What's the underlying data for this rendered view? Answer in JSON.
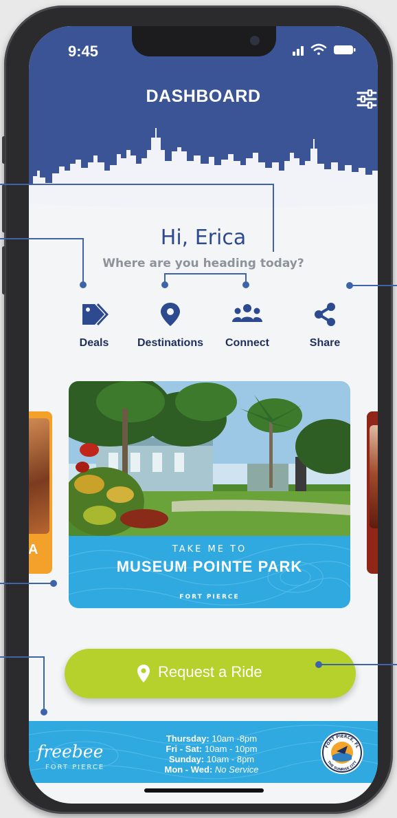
{
  "status": {
    "time": "9:45"
  },
  "header": {
    "title": "DASHBOARD"
  },
  "greeting": {
    "hello": "Hi, Erica",
    "question": "Where are you heading today?"
  },
  "quick_actions": [
    {
      "label": "Deals",
      "icon": "tag-icon"
    },
    {
      "label": "Destinations",
      "icon": "map-pin-icon"
    },
    {
      "label": "Connect",
      "icon": "users-icon"
    },
    {
      "label": "Share",
      "icon": "share-icon"
    }
  ],
  "destination_card": {
    "pre": "TAKE ME TO",
    "name": "MUSEUM POINTE PARK",
    "city": "FORT PIERCE",
    "side_left_letter": "A",
    "side_right_letter": "&"
  },
  "ride_button": {
    "label": "Request a Ride"
  },
  "footer": {
    "brand": "freebee",
    "brand_sub": "FORT PIERCE",
    "hours": [
      {
        "days": "Thursday:",
        "time": "10am -8pm",
        "italic": false
      },
      {
        "days": "Fri - Sat:",
        "time": "10am - 10pm",
        "italic": false
      },
      {
        "days": "Sunday:",
        "time": "10am - 8pm",
        "italic": false
      },
      {
        "days": "Mon - Wed:",
        "time": "No Service",
        "italic": true
      }
    ],
    "seal_top": "FORT PIERCE, FL",
    "seal_bottom": "THE SUNRISE CITY"
  },
  "colors": {
    "header_blue": "#3a5496",
    "brand_navy": "#1e2f5c",
    "ride_green": "#b6d12b",
    "banner_blue": "#2fa9e0"
  }
}
